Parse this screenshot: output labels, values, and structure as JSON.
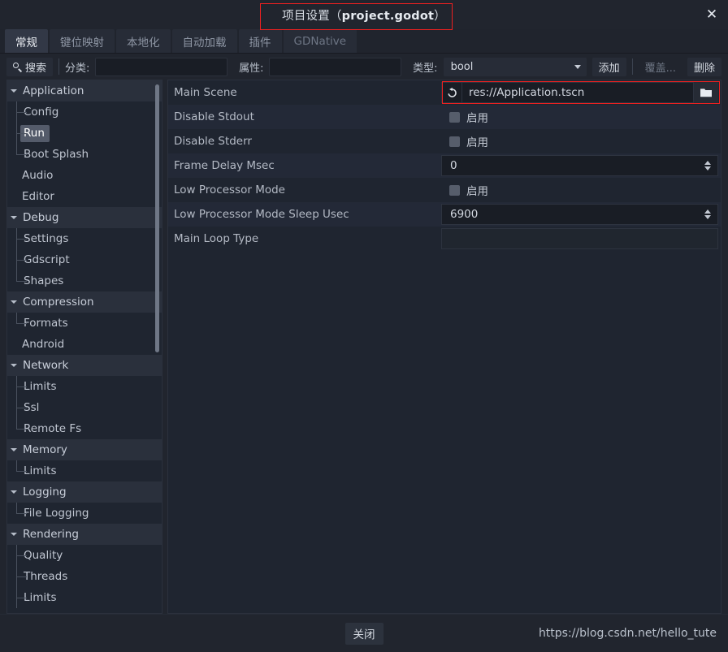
{
  "window": {
    "title_prefix": "项目设置（",
    "title_file": "project.godot",
    "title_suffix": "）",
    "close_icon": "close-icon",
    "accent_red": "#ee2020"
  },
  "tabs": [
    {
      "label": "常规",
      "state": "active"
    },
    {
      "label": "键位映射",
      "state": "normal"
    },
    {
      "label": "本地化",
      "state": "normal"
    },
    {
      "label": "自动加载",
      "state": "normal"
    },
    {
      "label": "插件",
      "state": "normal"
    },
    {
      "label": "GDNative",
      "state": "disabled"
    }
  ],
  "toolbar": {
    "search_label": "搜索",
    "search_icon": "search-icon",
    "category_label": "分类:",
    "category_value": "",
    "property_label": "属性:",
    "property_value": "",
    "type_label": "类型:",
    "type_value": "bool",
    "type_options": [
      "bool"
    ],
    "add_label": "添加",
    "override_label": "覆盖...",
    "delete_label": "删除"
  },
  "tree": {
    "items": [
      {
        "label": "Application",
        "kind": "group",
        "expanded": true,
        "selected": false
      },
      {
        "label": "Config",
        "kind": "child",
        "selected": false,
        "last": false
      },
      {
        "label": "Run",
        "kind": "child",
        "selected": true,
        "last": false
      },
      {
        "label": "Boot Splash",
        "kind": "child",
        "selected": false,
        "last": true
      },
      {
        "label": "Audio",
        "kind": "plain",
        "selected": false
      },
      {
        "label": "Editor",
        "kind": "plain",
        "selected": false
      },
      {
        "label": "Debug",
        "kind": "group",
        "expanded": true,
        "selected": false
      },
      {
        "label": "Settings",
        "kind": "child",
        "selected": false,
        "last": false
      },
      {
        "label": "Gdscript",
        "kind": "child",
        "selected": false,
        "last": false
      },
      {
        "label": "Shapes",
        "kind": "child",
        "selected": false,
        "last": true
      },
      {
        "label": "Compression",
        "kind": "group",
        "expanded": true,
        "selected": false
      },
      {
        "label": "Formats",
        "kind": "child",
        "selected": false,
        "last": true
      },
      {
        "label": "Android",
        "kind": "plain",
        "selected": false
      },
      {
        "label": "Network",
        "kind": "group",
        "expanded": true,
        "selected": false
      },
      {
        "label": "Limits",
        "kind": "child",
        "selected": false,
        "last": false
      },
      {
        "label": "Ssl",
        "kind": "child",
        "selected": false,
        "last": false
      },
      {
        "label": "Remote Fs",
        "kind": "child",
        "selected": false,
        "last": true
      },
      {
        "label": "Memory",
        "kind": "group",
        "expanded": true,
        "selected": false
      },
      {
        "label": "Limits",
        "kind": "child",
        "selected": false,
        "last": true
      },
      {
        "label": "Logging",
        "kind": "group",
        "expanded": true,
        "selected": false
      },
      {
        "label": "File Logging",
        "kind": "child",
        "selected": false,
        "last": true
      },
      {
        "label": "Rendering",
        "kind": "group",
        "expanded": true,
        "selected": false
      },
      {
        "label": "Quality",
        "kind": "child",
        "selected": false,
        "last": false
      },
      {
        "label": "Threads",
        "kind": "child",
        "selected": false,
        "last": false
      },
      {
        "label": "Limits",
        "kind": "child",
        "selected": false,
        "last": false
      }
    ]
  },
  "properties": {
    "enable_label": "启用",
    "rows": [
      {
        "name": "Main Scene",
        "type": "path",
        "value": "res://Application.tscn",
        "revert_icon": "revert-icon",
        "browse_icon": "folder-icon",
        "highlighted": true
      },
      {
        "name": "Disable Stdout",
        "type": "checkbox",
        "checked": false
      },
      {
        "name": "Disable Stderr",
        "type": "checkbox",
        "checked": false
      },
      {
        "name": "Frame Delay Msec",
        "type": "spin",
        "value": "0"
      },
      {
        "name": "Low Processor Mode",
        "type": "checkbox",
        "checked": false
      },
      {
        "name": "Low Processor Mode Sleep Usec",
        "type": "spin",
        "value": "6900"
      },
      {
        "name": "Main Loop Type",
        "type": "text",
        "value": ""
      }
    ]
  },
  "footer": {
    "close_label": "关闭",
    "watermark": "https://blog.csdn.net/hello_tute"
  }
}
